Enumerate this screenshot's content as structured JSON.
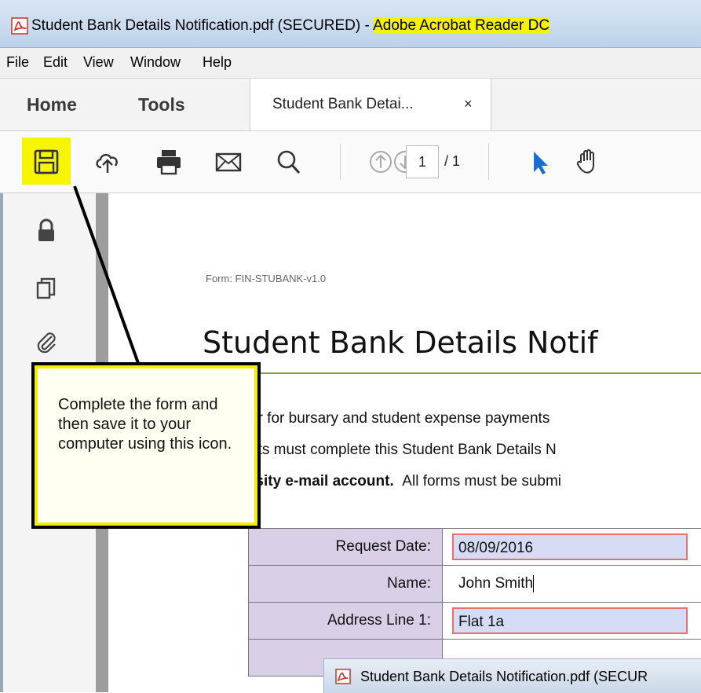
{
  "window": {
    "title_prefix": "Student Bank Details Notification.pdf (SECURED) - ",
    "title_app": "Adobe Acrobat Reader DC"
  },
  "menu": [
    "File",
    "Edit",
    "View",
    "Window",
    "Help"
  ],
  "tabs": {
    "home": "Home",
    "tools": "Tools",
    "document": "Student Bank Detai...",
    "close": "×"
  },
  "toolbar": {
    "page_current": "1",
    "page_total": "/ 1",
    "icons": [
      "save-icon",
      "upload-cloud-icon",
      "print-icon",
      "email-icon",
      "search-icon",
      "page-up-icon",
      "page-down-icon",
      "select-arrow-icon",
      "hand-tool-icon"
    ],
    "highlight_color": "#f7f500"
  },
  "left_panel": {
    "icons": [
      "lock-icon",
      "pages-icon",
      "attachment-icon"
    ]
  },
  "document": {
    "form_id": "Form: FIN-STUBANK-v1.0",
    "heading": "Student Bank Details Notif",
    "paragraph": [
      "er for bursary and student expense payments",
      "nts must complete this Student Bank Details N",
      "rsity e-mail account.",
      "All forms must be submi"
    ],
    "fields": [
      {
        "label": "Request Date:",
        "value": "08/09/2016",
        "style": "highlighted"
      },
      {
        "label": "Name:",
        "value": "John Smith",
        "style": "plain"
      },
      {
        "label": "Address Line 1:",
        "value": "Flat 1a",
        "style": "highlighted"
      }
    ]
  },
  "callout": {
    "text": "Complete the form and then save it to your computer using this icon."
  },
  "taskbar_preview": {
    "label": "Student Bank Details Notification.pdf (SECUR"
  }
}
